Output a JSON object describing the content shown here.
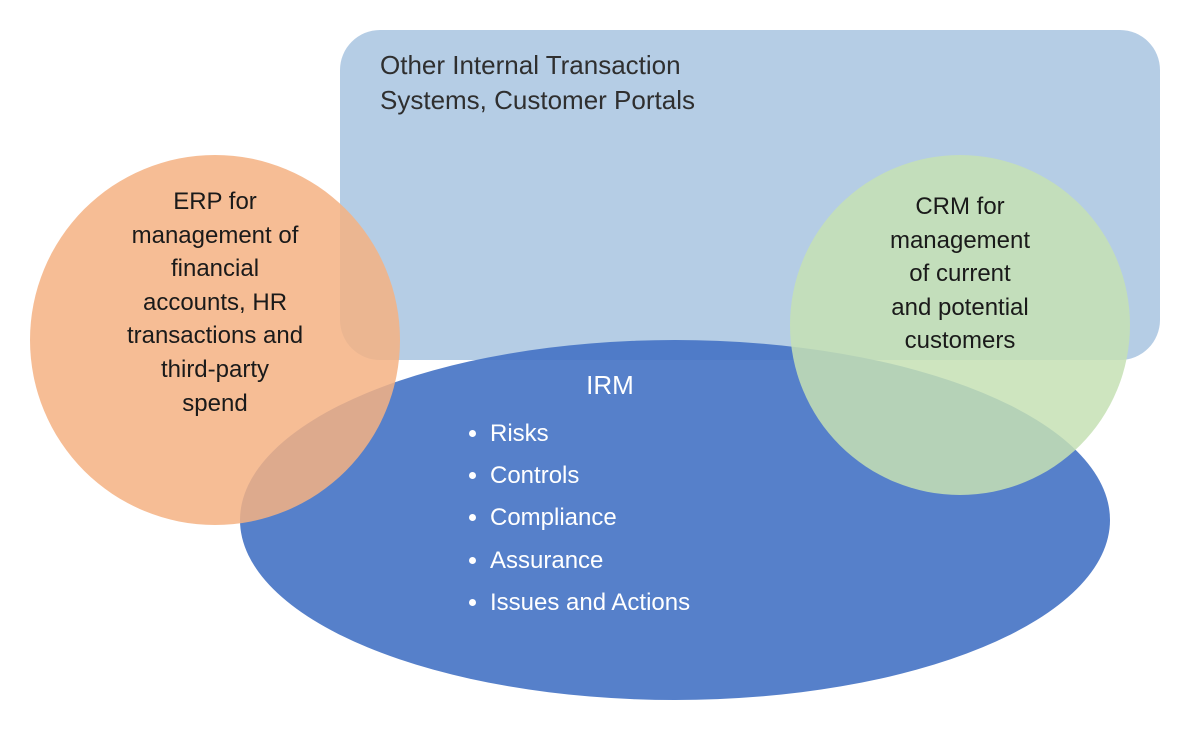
{
  "diagram": {
    "blue_rect_label": "Other Internal Transaction\nSystems, Customer Portals",
    "orange_label": "ERP for\nmanagement of\nfinancial\naccounts, HR\ntransactions and\nthird-party\nspend",
    "green_label": "CRM for\nmanagement\nof current\nand potential\ncustomers",
    "irm_title": "IRM",
    "irm_items": [
      "Risks",
      "Controls",
      "Compliance",
      "Assurance",
      "Issues and Actions"
    ]
  },
  "colors": {
    "blue_rect": "#a8c4e0",
    "blue_ellipse": "#4472c4",
    "orange_circle": "#f4b183",
    "green_circle": "#c6e0b4",
    "irm_text": "#ffffff",
    "dark_text": "#1a1a1a"
  }
}
